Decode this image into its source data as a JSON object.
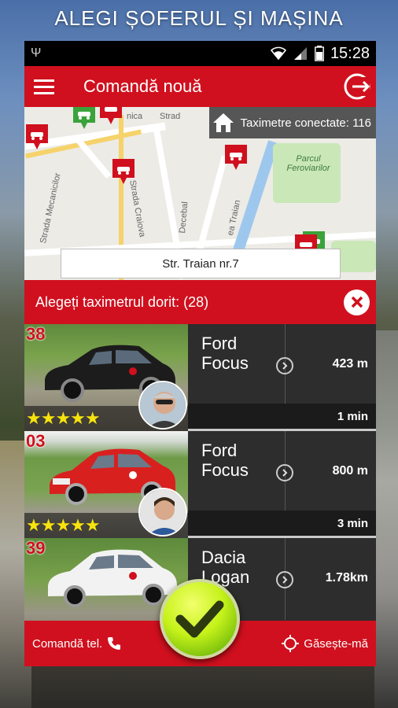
{
  "banner": {
    "text": "ALEGI ȘOFERUL ȘI MAȘINA"
  },
  "status_bar": {
    "time": "15:28",
    "usb_icon": "usb-icon",
    "wifi_icon": "wifi-icon",
    "signal_icon": "signal-icon",
    "battery_icon": "battery-icon"
  },
  "app_bar": {
    "title": "Comandă nouă",
    "menu_icon": "hamburger-icon",
    "logout_icon": "logout-icon"
  },
  "map": {
    "connected_label": "Taximetre conectate: 116",
    "address": "Str. Traian nr.7",
    "streets": [
      "Strada Mecanicilor",
      "Strada Craiova",
      "Decebal",
      "ea Traian",
      "Parcul Feroviarilor",
      "Strad",
      "nica"
    ]
  },
  "choose_bar": {
    "label": "Alegeți taximetrul dorit: (28)",
    "close_icon": "close-icon"
  },
  "taxis": [
    {
      "number": "38",
      "model": "Ford Focus",
      "distance": "423 m",
      "time": "1 min",
      "stars": "★★★★★",
      "car_color": "#1c1c1c"
    },
    {
      "number": "03",
      "model": "Ford Focus",
      "distance": "800 m",
      "time": "3 min",
      "stars": "★★★★★",
      "car_color": "#d8201f"
    },
    {
      "number": "39",
      "model": "Dacia Logan",
      "distance": "1.78km",
      "time": "",
      "stars": "",
      "car_color": "#f2f2f2"
    }
  ],
  "bottom_bar": {
    "phone_order": "Comandă tel.",
    "find_me": "Găsește-mă"
  },
  "colors": {
    "accent": "#d0101e",
    "confirm": "#b5e61d",
    "stars": "#f7e30d"
  }
}
